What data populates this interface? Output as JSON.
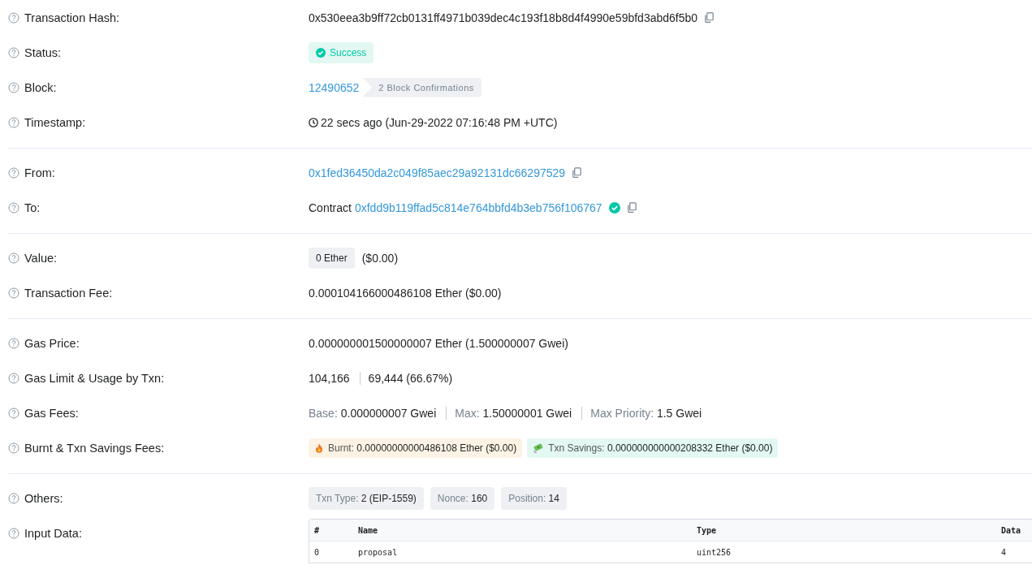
{
  "sections": [
    {
      "rows": [
        {
          "label": "Transaction Hash:",
          "kind": "hash",
          "value": "0x530eea3b9ff72cb0131ff4971b039dec4c193f18b8d4f4990e59bfd3abd6f5b0"
        },
        {
          "label": "Status:",
          "kind": "status",
          "status": "Success"
        },
        {
          "label": "Block:",
          "kind": "block",
          "value": "12490652",
          "confirmations": "2 Block Confirmations"
        },
        {
          "label": "Timestamp:",
          "kind": "timestamp",
          "value": "22 secs ago (Jun-29-2022 07:16:48 PM +UTC)"
        }
      ]
    },
    {
      "rows": [
        {
          "label": "From:",
          "kind": "address",
          "value": "0x1fed36450da2c049f85aec29a92131dc66297529"
        },
        {
          "label": "To:",
          "kind": "contract",
          "prefix": "Contract",
          "value": "0xfdd9b119ffad5c814e764bbfd4b3eb756f106767",
          "verified": true
        }
      ]
    },
    {
      "rows": [
        {
          "label": "Value:",
          "kind": "value",
          "amount": "0 Ether",
          "usd": "($0.00)"
        },
        {
          "label": "Transaction Fee:",
          "kind": "text",
          "value": "0.000104166000486108 Ether ($0.00)"
        }
      ]
    },
    {
      "rows": [
        {
          "label": "Gas Price:",
          "kind": "text",
          "value": "0.000000001500000007 Ether (1.500000007 Gwei)"
        },
        {
          "label": "Gas Limit & Usage by Txn:",
          "kind": "split",
          "parts": [
            "104,166",
            "69,444 (66.67%)"
          ]
        },
        {
          "label": "Gas Fees:",
          "kind": "fees",
          "parts": [
            {
              "name": "Base:",
              "value": "0.000000007 Gwei"
            },
            {
              "name": "Max:",
              "value": "1.50000001 Gwei"
            },
            {
              "name": "Max Priority:",
              "value": "1.5 Gwei"
            }
          ]
        },
        {
          "label": "Burnt & Txn Savings Fees:",
          "kind": "badges",
          "badges": [
            {
              "kind": "burnt",
              "name": "Burnt:",
              "value": "0.00000000000486108 Ether ($0.00)"
            },
            {
              "kind": "savings",
              "name": "Txn Savings:",
              "value": "0.000000000000208332 Ether ($0.00)"
            }
          ]
        }
      ]
    },
    {
      "rows": [
        {
          "label": "Others:",
          "kind": "tags",
          "tags": [
            {
              "name": "Txn Type:",
              "value": "2 (EIP-1559)"
            },
            {
              "name": "Nonce:",
              "value": "160"
            },
            {
              "name": "Position:",
              "value": "14"
            }
          ]
        },
        {
          "label": "Input Data:",
          "kind": "table",
          "table": {
            "columns": [
              "#",
              "Name",
              "Type",
              "Data"
            ],
            "rows": [
              [
                "0",
                "proposal",
                "uint256",
                "4"
              ]
            ]
          }
        }
      ]
    }
  ]
}
